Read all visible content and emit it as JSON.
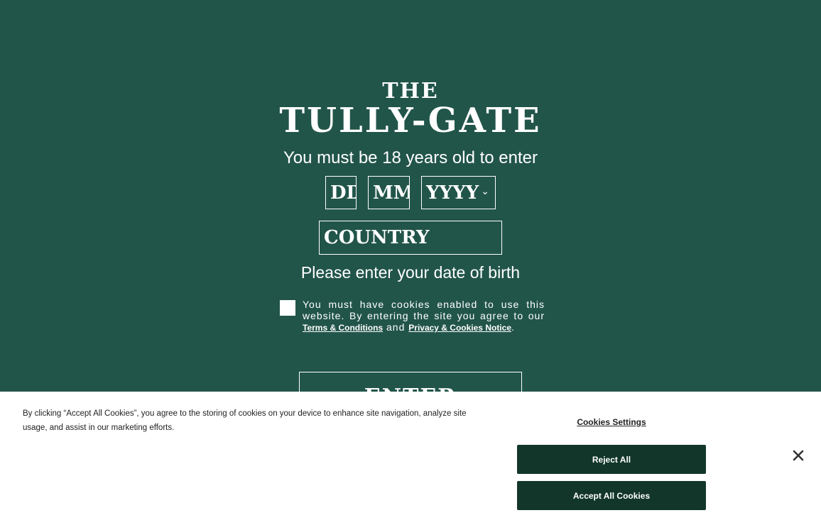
{
  "logo": {
    "line1": "THE",
    "line2": "TULLY-GATE"
  },
  "age_gate": {
    "age_message": "You must be 18 years old to enter",
    "day_placeholder": "DD",
    "month_placeholder": "MM",
    "year_placeholder": "YYYY",
    "country_placeholder": "COUNTRY",
    "dob_prompt": "Please enter your date of birth",
    "cookie_notice": "You must have cookies enabled to use this website. By entering the site you agree to our",
    "terms_link": "Terms & Conditions",
    "and_text": "and",
    "privacy_link": "Privacy & Cookies Notice",
    "period": ".",
    "enter_label": "ENTER"
  },
  "cookie_banner": {
    "text": "By clicking “Accept All Cookies”, you agree to the storing of cookies on your device to enhance site navigation, analyze site usage, and assist in our marketing efforts.",
    "settings_label": "Cookies Settings",
    "reject_label": "Reject All",
    "accept_label": "Accept All Cookies"
  },
  "colors": {
    "background": "#22554a",
    "button_dark": "#12362a",
    "banner": "#ffffff"
  },
  "icons": {
    "year_dropdown": "chevron-down-icon",
    "banner_close": "close-icon"
  }
}
